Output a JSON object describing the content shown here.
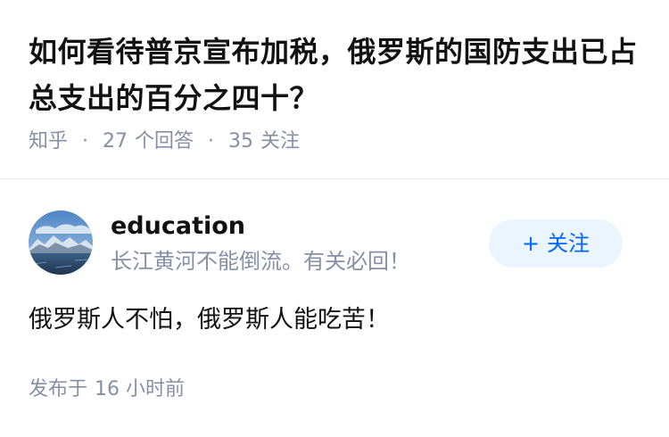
{
  "question": {
    "title": "如何看待普京宣布加税，俄罗斯的国防支出已占总支出的百分之四十？",
    "source": "知乎",
    "answers_count": "27",
    "answers_label": "个回答",
    "followers_count": "35",
    "followers_label": "关注"
  },
  "author": {
    "name": "education",
    "bio": "长江黄河不能倒流。有关必回！",
    "avatar_icon": "mountain-lake-avatar-icon",
    "follow_plus": "+",
    "follow_label": "关注"
  },
  "answer": {
    "content": "俄罗斯人不怕，俄罗斯人能吃苦！",
    "published_label": "发布于",
    "published_time": "16 小时前"
  },
  "colors": {
    "accent": "#0066ff",
    "follow_bg": "#ebf5ff",
    "muted_text": "#8590a6",
    "divider": "#ebebeb"
  }
}
